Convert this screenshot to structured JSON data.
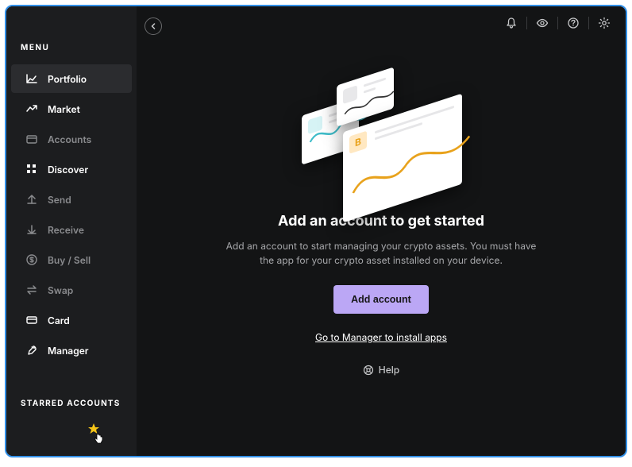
{
  "sidebar": {
    "menu_heading": "MENU",
    "starred_heading": "STARRED ACCOUNTS",
    "items": [
      {
        "label": "Portfolio"
      },
      {
        "label": "Market"
      },
      {
        "label": "Accounts"
      },
      {
        "label": "Discover"
      },
      {
        "label": "Send"
      },
      {
        "label": "Receive"
      },
      {
        "label": "Buy / Sell"
      },
      {
        "label": "Swap"
      },
      {
        "label": "Card"
      },
      {
        "label": "Manager"
      }
    ]
  },
  "main": {
    "headline": "Add an account to get started",
    "subtext": "Add an account to start managing your crypto assets. You must have the app for your crypto asset installed on your device.",
    "add_button": "Add account",
    "manager_link": "Go to Manager to install apps",
    "help_label": "Help"
  }
}
